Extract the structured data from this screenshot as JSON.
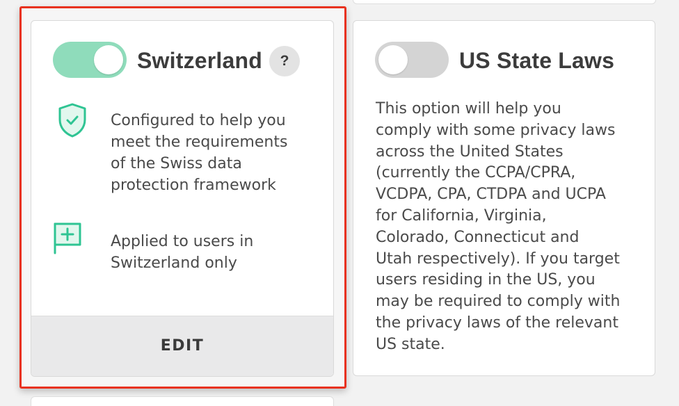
{
  "colors": {
    "accent": "#2fc493",
    "toggle_on": "#8fdcbb",
    "toggle_off": "#d4d4d4",
    "highlight_border": "#e8321f"
  },
  "cards": {
    "switzerland": {
      "title": "Switzerland",
      "enabled": true,
      "help_label": "?",
      "features": [
        {
          "icon": "shield-check-icon",
          "text": "Configured to help you\nmeet the requirements\nof the Swiss data\nprotection framework"
        },
        {
          "icon": "flag-plus-icon",
          "text": "Applied to users in\nSwitzerland only"
        }
      ],
      "edit_label": "EDIT"
    },
    "us_state_laws": {
      "title": "US State Laws",
      "enabled": false,
      "description": "This option will help you\ncomply with some privacy laws\nacross the United States\n(currently the CCPA/CPRA,\nVCDPA, CPA, CTDPA and UCPA\nfor California, Virginia,\nColorado, Connecticut and\nUtah respectively). If you target\nusers residing in the US, you\nmay be required to comply with\nthe privacy laws of the relevant\nUS state."
    }
  }
}
